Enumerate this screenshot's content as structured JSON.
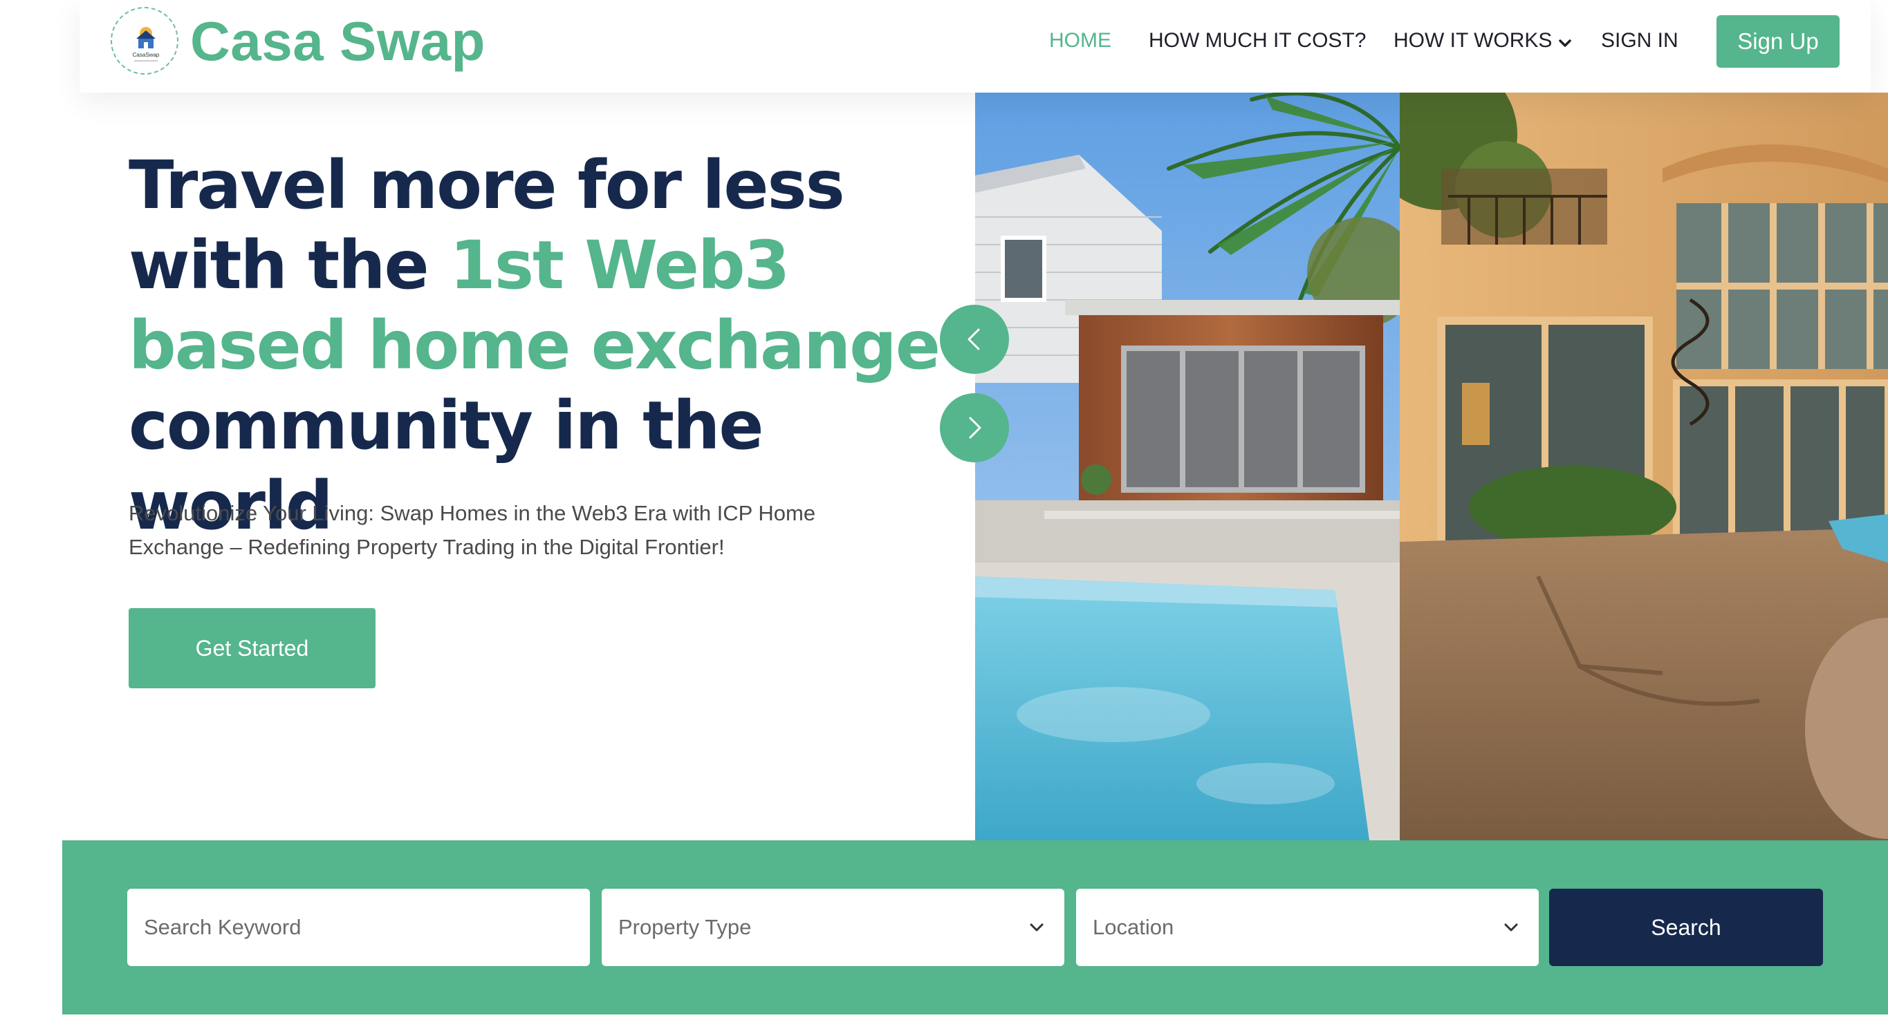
{
  "header": {
    "brand": "Casa Swap",
    "logo_caption": "CasaSwap",
    "nav": {
      "home": "HOME",
      "cost": "HOW MUCH IT COST?",
      "how_it_works": "HOW IT WORKS",
      "sign_in": "SIGN IN"
    },
    "signup_label": "Sign Up"
  },
  "hero": {
    "title_line1": "Travel more for less",
    "title_line2_start": "with the ",
    "title_line2_accent": "1st Web3",
    "title_line3": "based home exchange",
    "title_line4": "community in the world",
    "subtitle": "Revolutionize Your Living: Swap Homes in the Web3 Era with ICP Home Exchange – Redefining Property Trading in the Digital Frontier!",
    "cta_label": "Get Started"
  },
  "gallery": {
    "prev_icon": "chevron-left-icon",
    "next_icon": "chevron-right-icon"
  },
  "search": {
    "keyword_placeholder": "Search Keyword",
    "property_type": "Property Type",
    "location": "Location",
    "button_label": "Search"
  },
  "colors": {
    "brand_green": "#55b58c",
    "navy": "#16294d"
  }
}
